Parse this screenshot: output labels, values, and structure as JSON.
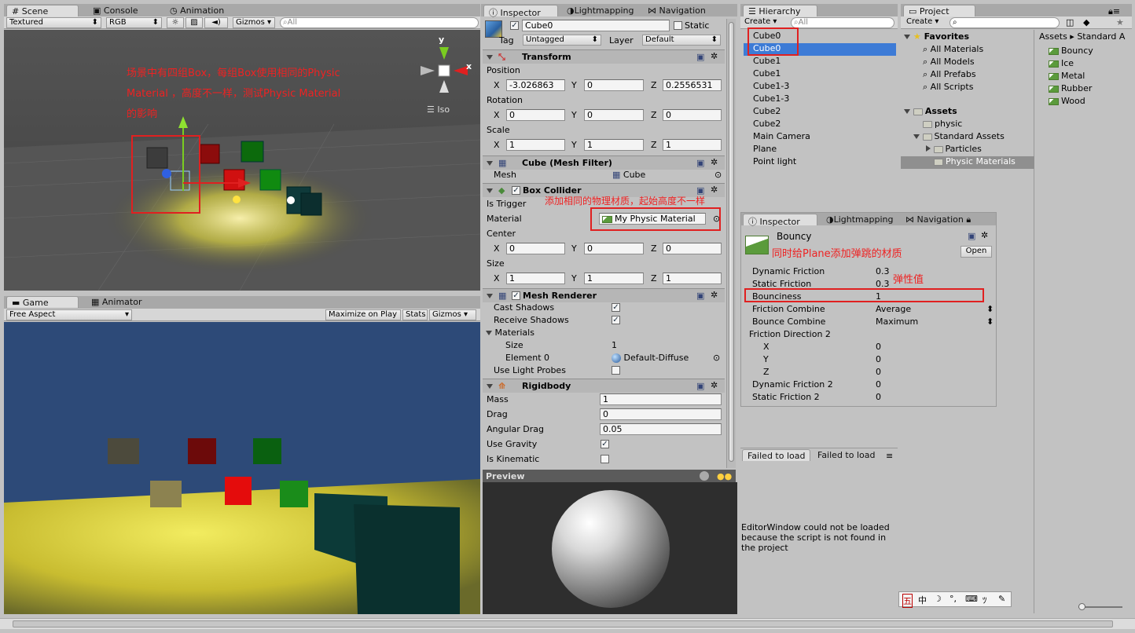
{
  "scene": {
    "tabs": [
      "Scene",
      "Console",
      "Animation"
    ],
    "toolbar": {
      "shading": "Textured",
      "render_mode": "RGB",
      "gizmos": "Gizmos",
      "search_placeholder": "All"
    },
    "gizmo_labels": {
      "y": "y",
      "x": "x",
      "projection": "Iso"
    },
    "annotation": [
      "场景中有四组Box，每组Box使用相同的Physic",
      "Material ，高度不一样，测试Physic Material",
      "的影响"
    ]
  },
  "game": {
    "tabs": [
      "Game",
      "Animator"
    ],
    "toolbar": {
      "aspect": "Free Aspect",
      "maximize": "Maximize on Play",
      "stats": "Stats",
      "gizmos": "Gizmos"
    }
  },
  "inspector": {
    "tabs": [
      "Inspector",
      "Lightmapping",
      "Navigation"
    ],
    "object_name": "Cube0",
    "static_label": "Static",
    "tag_label": "Tag",
    "tag_value": "Untagged",
    "layer_label": "Layer",
    "layer_value": "Default",
    "transform": {
      "title": "Transform",
      "position_label": "Position",
      "position": [
        "-3.026863",
        "0",
        "0.2556531"
      ],
      "rotation_label": "Rotation",
      "rotation": [
        "0",
        "0",
        "0"
      ],
      "scale_label": "Scale",
      "scale": [
        "1",
        "1",
        "1"
      ],
      "axes": [
        "X",
        "Y",
        "Z"
      ]
    },
    "mesh_filter": {
      "title": "Cube (Mesh Filter)",
      "mesh_label": "Mesh",
      "mesh_value": "Cube"
    },
    "box_collider": {
      "title": "Box Collider",
      "is_trigger_label": "Is Trigger",
      "material_label": "Material",
      "material_value": "My Physic Material",
      "center_label": "Center",
      "center": [
        "0",
        "0",
        "0"
      ],
      "size_label": "Size",
      "size": [
        "1",
        "1",
        "1"
      ]
    },
    "collider_note": "添加相同的物理材质，起始高度不一样",
    "mesh_renderer": {
      "title": "Mesh Renderer",
      "cast_shadows": "Cast Shadows",
      "receive_shadows": "Receive Shadows",
      "materials": "Materials",
      "size_label": "Size",
      "size_value": "1",
      "element0_label": "Element 0",
      "element0_value": "Default-Diffuse",
      "light_probes": "Use Light Probes"
    },
    "rigidbody": {
      "title": "Rigidbody",
      "mass_label": "Mass",
      "mass": "1",
      "drag_label": "Drag",
      "drag": "0",
      "angular_drag_label": "Angular Drag",
      "angular_drag": "0.05",
      "use_gravity": "Use Gravity",
      "is_kinematic": "Is Kinematic"
    },
    "preview_label": "Preview"
  },
  "hierarchy": {
    "tab": "Hierarchy",
    "create": "Create",
    "search_placeholder": "All",
    "items": [
      "Cube0",
      "Cube0",
      "Cube1",
      "Cube1",
      "Cube1-3",
      "Cube1-3",
      "Cube2",
      "Cube2",
      "Main Camera",
      "Plane",
      "Point light"
    ]
  },
  "project": {
    "tab": "Project",
    "create": "Create",
    "favorites": "Favorites",
    "favorite_items": [
      "All Materials",
      "All Models",
      "All Prefabs",
      "All Scripts"
    ],
    "assets": "Assets",
    "asset_tree": [
      "physic",
      "Standard Assets",
      "Particles",
      "Physic Materials"
    ],
    "breadcrumb": [
      "Assets",
      "Standard A"
    ],
    "files": [
      "Bouncy",
      "Ice",
      "Metal",
      "Rubber",
      "Wood"
    ]
  },
  "inspector2": {
    "tabs": [
      "Inspector",
      "Lightmapping",
      "Navigation"
    ],
    "asset_name": "Bouncy",
    "open_button": "Open",
    "note_plane": "同时给Plane添加弹跳的材质",
    "note_bounce": "弹性值",
    "props": [
      {
        "label": "Dynamic Friction",
        "value": "0.3"
      },
      {
        "label": "Static Friction",
        "value": "0.3"
      },
      {
        "label": "Bounciness",
        "value": "1"
      },
      {
        "label": "Friction Combine",
        "value": "Average"
      },
      {
        "label": "Bounce Combine",
        "value": "Maximum"
      },
      {
        "label": "Friction Direction 2",
        "value": ""
      },
      {
        "label": "X",
        "value": "0"
      },
      {
        "label": "Y",
        "value": "0"
      },
      {
        "label": "Z",
        "value": "0"
      },
      {
        "label": "Dynamic Friction 2",
        "value": "0"
      },
      {
        "label": "Static Friction 2",
        "value": "0"
      }
    ]
  },
  "failed": {
    "tabs": [
      "Failed to load",
      "Failed to load"
    ],
    "message": [
      "EditorWindow could not be loaded",
      "because the script is not found in",
      "the project"
    ]
  },
  "ime_bar": [
    "五",
    "中",
    "☽",
    "°,",
    "⌨",
    "ﾂ",
    "🔧"
  ]
}
